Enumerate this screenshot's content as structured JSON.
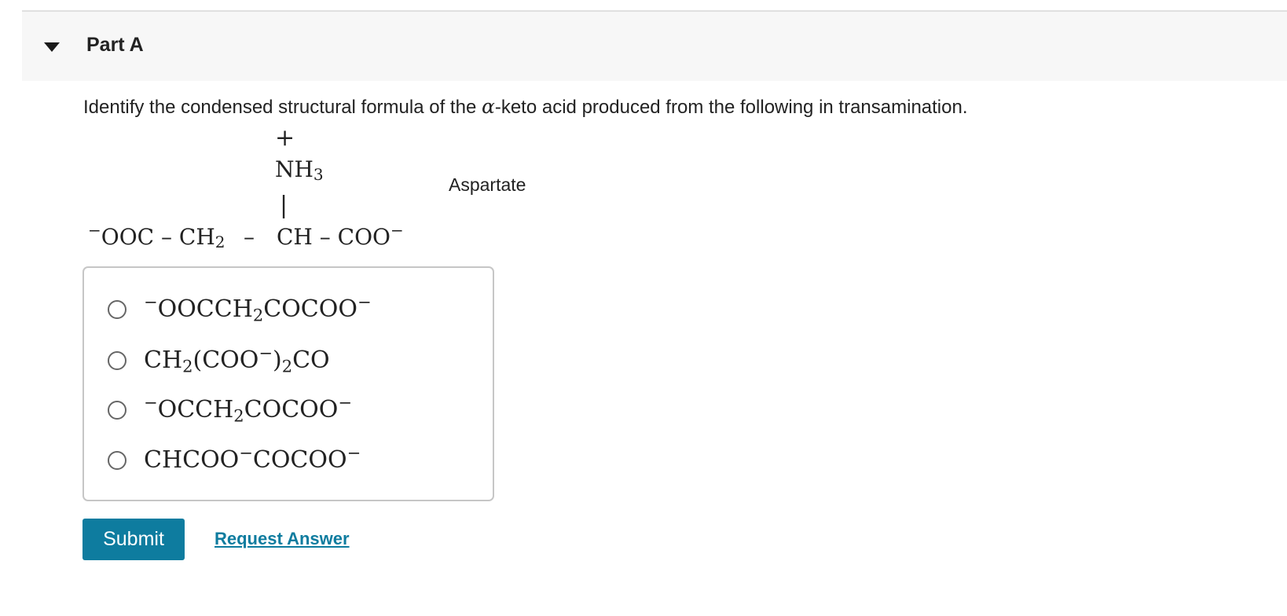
{
  "part": {
    "title": "Part A",
    "toggle_icon": "caret-down-icon"
  },
  "question": {
    "prompt_before": "Identify the condensed structural formula of the ",
    "prompt_symbol": "α",
    "prompt_after": "-keto acid produced from the following in transamination."
  },
  "structure": {
    "charge": "+",
    "amino_group": "NH",
    "amino_subscript": "3",
    "bond_vertical": "|",
    "backbone_left_charge": "−",
    "backbone_left": "OOC – CH",
    "backbone_left_subscript": "2",
    "backbone_middle": "–",
    "backbone_right": "CH – COO",
    "backbone_right_charge": "−",
    "name": "Aspartate"
  },
  "choices": [
    {
      "parts": [
        {
          "t": "sup",
          "v": "−"
        },
        {
          "t": "text",
          "v": "OOCCH"
        },
        {
          "t": "sub",
          "v": "2"
        },
        {
          "t": "text",
          "v": "COCOO"
        },
        {
          "t": "sup",
          "v": "−"
        }
      ]
    },
    {
      "parts": [
        {
          "t": "text",
          "v": "CH"
        },
        {
          "t": "sub",
          "v": "2"
        },
        {
          "t": "text",
          "v": "(COO"
        },
        {
          "t": "sup",
          "v": "−"
        },
        {
          "t": "text",
          "v": ")"
        },
        {
          "t": "sub",
          "v": "2"
        },
        {
          "t": "text",
          "v": "CO"
        }
      ]
    },
    {
      "parts": [
        {
          "t": "sup",
          "v": "−"
        },
        {
          "t": "text",
          "v": "OCCH"
        },
        {
          "t": "sub",
          "v": "2"
        },
        {
          "t": "text",
          "v": "COCOO"
        },
        {
          "t": "sup",
          "v": "−"
        }
      ]
    },
    {
      "parts": [
        {
          "t": "text",
          "v": "CHCOO"
        },
        {
          "t": "sup",
          "v": "−"
        },
        {
          "t": "text",
          "v": "COCOO"
        },
        {
          "t": "sup",
          "v": "−"
        }
      ]
    }
  ],
  "actions": {
    "submit_label": "Submit",
    "request_answer_label": "Request Answer"
  },
  "colors": {
    "accent": "#0e7c9f",
    "header_bg": "#f7f7f7",
    "border": "#c6c6c6"
  }
}
